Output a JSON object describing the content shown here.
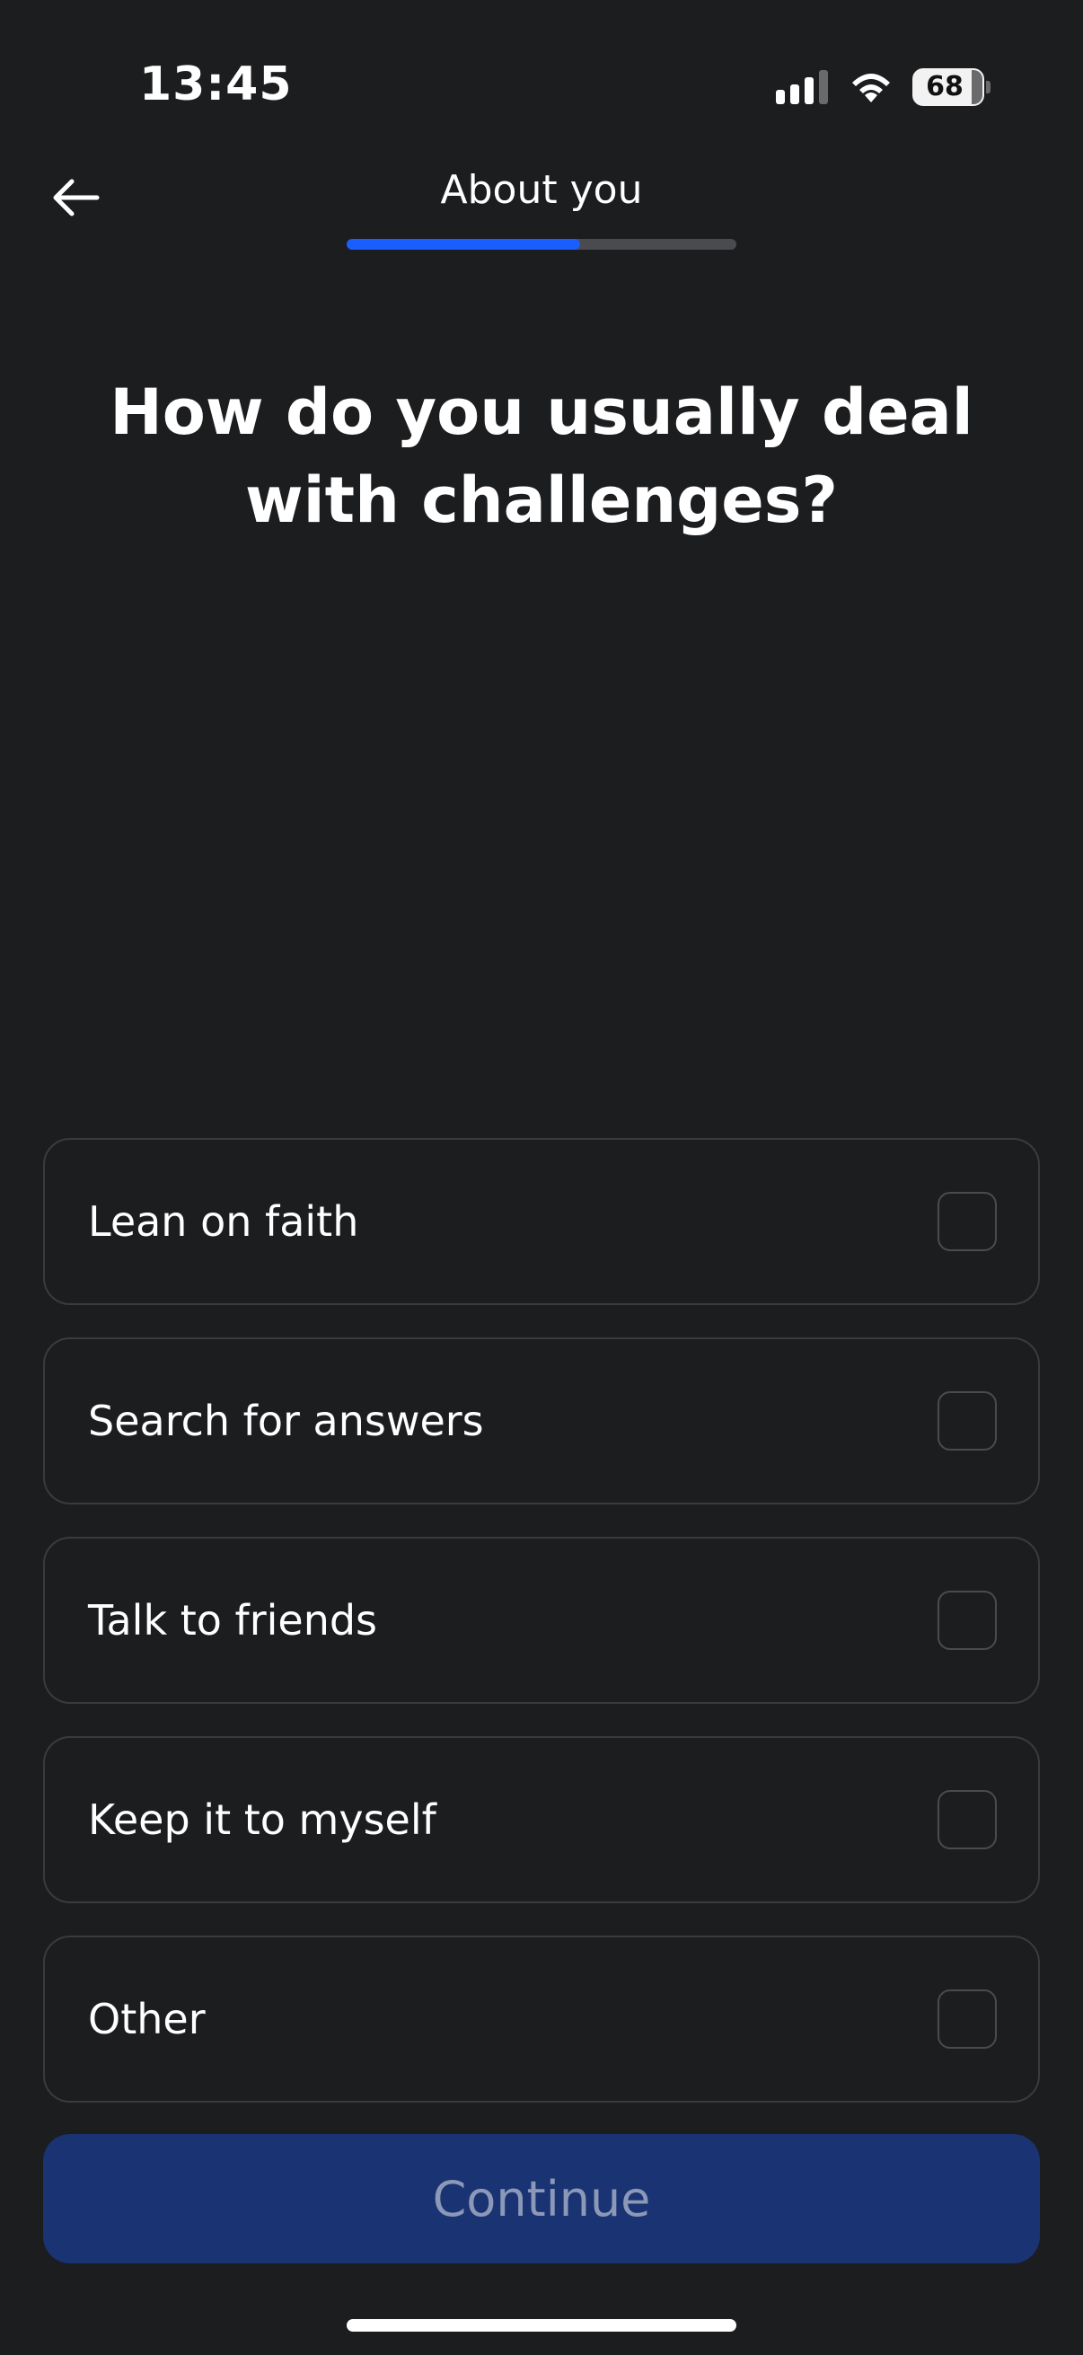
{
  "status_bar": {
    "time": "13:45",
    "battery": "68",
    "icons": [
      "signal-icon",
      "wifi-icon",
      "battery-icon"
    ]
  },
  "header": {
    "back_icon": "arrow-left-icon",
    "title": "About you",
    "progress_fraction": 0.6,
    "progress_color": "#1a5eff"
  },
  "question": "How do you usually deal with challenges?",
  "options": [
    {
      "label": "Lean on faith",
      "checked": false
    },
    {
      "label": "Search for answers",
      "checked": false
    },
    {
      "label": "Talk to friends",
      "checked": false
    },
    {
      "label": "Keep it to myself",
      "checked": false
    },
    {
      "label": "Other",
      "checked": false
    }
  ],
  "continue_label": "Continue",
  "colors": {
    "background": "#1c1d1f",
    "continue_bg": "#1a3372",
    "continue_text": "#8c98b8"
  }
}
